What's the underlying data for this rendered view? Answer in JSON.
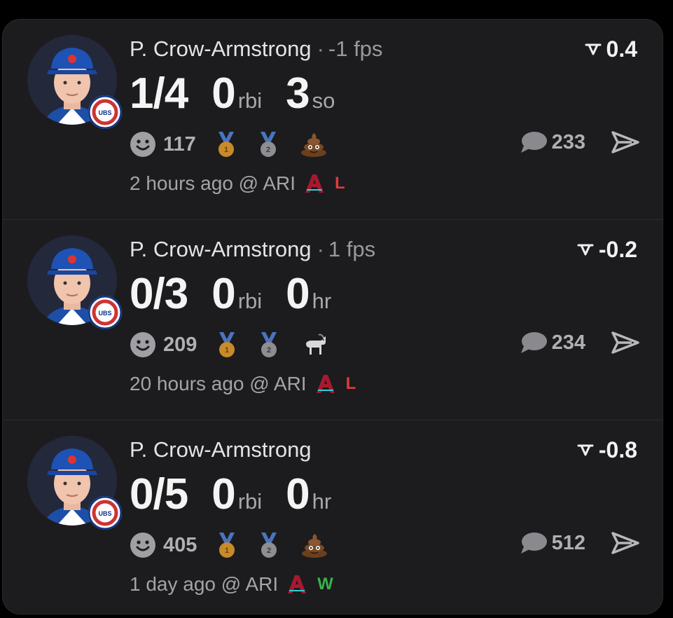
{
  "colors": {
    "background": "#000000",
    "card": "#1c1c1e",
    "loss": "#e03b3b",
    "win": "#37b24d",
    "cubs_blue": "#0e3386",
    "cubs_red": "#cc3433"
  },
  "posts": [
    {
      "player": "P. Crow-Armstrong",
      "separator": "·",
      "fps": "-1 fps",
      "score": "0.4",
      "stat1": "1/4",
      "stat2_value": "0",
      "stat2_unit": "rbi",
      "stat3_value": "3",
      "stat3_unit": "so",
      "reaction_count": "117",
      "badges": [
        "gold-medal-icon",
        "silver-medal-icon",
        "poop-emoji-icon"
      ],
      "comment_count": "233",
      "time": "2 hours ago @ ARI",
      "result": "L",
      "result_color": "#e03b3b"
    },
    {
      "player": "P. Crow-Armstrong",
      "separator": "·",
      "fps": "1 fps",
      "score": "-0.2",
      "stat1": "0/3",
      "stat2_value": "0",
      "stat2_unit": "rbi",
      "stat3_value": "0",
      "stat3_unit": "hr",
      "reaction_count": "209",
      "badges": [
        "gold-medal-icon",
        "silver-medal-icon",
        "goat-emoji-icon"
      ],
      "comment_count": "234",
      "time": "20 hours ago @ ARI",
      "result": "L",
      "result_color": "#e03b3b"
    },
    {
      "player": "P. Crow-Armstrong",
      "separator": "",
      "fps": "",
      "score": "-0.8",
      "stat1": "0/5",
      "stat2_value": "0",
      "stat2_unit": "rbi",
      "stat3_value": "0",
      "stat3_unit": "hr",
      "reaction_count": "405",
      "badges": [
        "gold-medal-icon",
        "silver-medal-icon",
        "poop-emoji-icon"
      ],
      "comment_count": "512",
      "time": "1 day ago @ ARI",
      "result": "W",
      "result_color": "#37b24d"
    }
  ]
}
